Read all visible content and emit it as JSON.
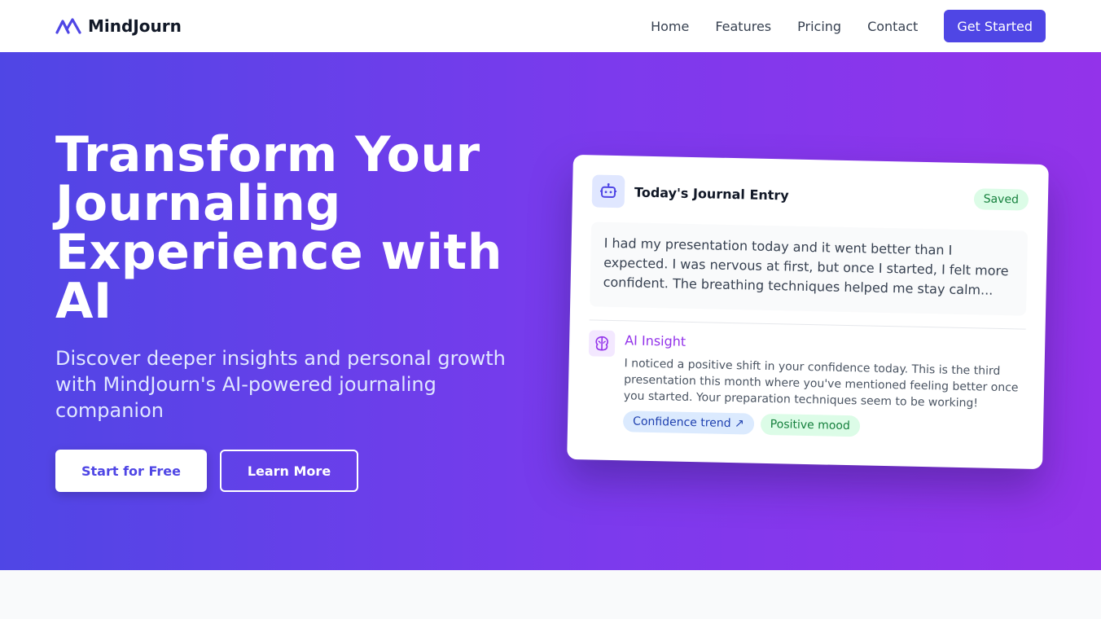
{
  "brand": {
    "name": "MindJourn",
    "logo_icon": "mountain-logo-icon",
    "accent": "#4f46e5"
  },
  "nav": {
    "links": [
      "Home",
      "Features",
      "Pricing",
      "Contact"
    ],
    "cta_label": "Get Started"
  },
  "hero": {
    "title": "Transform Your Journaling Experience with AI",
    "subtitle": "Discover deeper insights and personal growth with MindJourn's AI-powered journaling companion",
    "primary_button": "Start for Free",
    "secondary_button": "Learn More",
    "gradient_start": "#4f46e5",
    "gradient_end": "#9333ea"
  },
  "card": {
    "icon": "robot-icon",
    "title": "Today's Journal Entry",
    "status": "Saved",
    "entry_text": "I had my presentation today and it went better than I expected. I was nervous at first, but once I started, I felt more confident. The breathing techniques helped me stay calm...",
    "insight": {
      "icon": "brain-icon",
      "label": "AI Insight",
      "text": "I noticed a positive shift in your confidence today. This is the third presentation this month where you've mentioned feeling better once you started. Your preparation techniques seem to be working!",
      "tags": [
        "Confidence trend ↗",
        "Positive mood"
      ]
    }
  }
}
